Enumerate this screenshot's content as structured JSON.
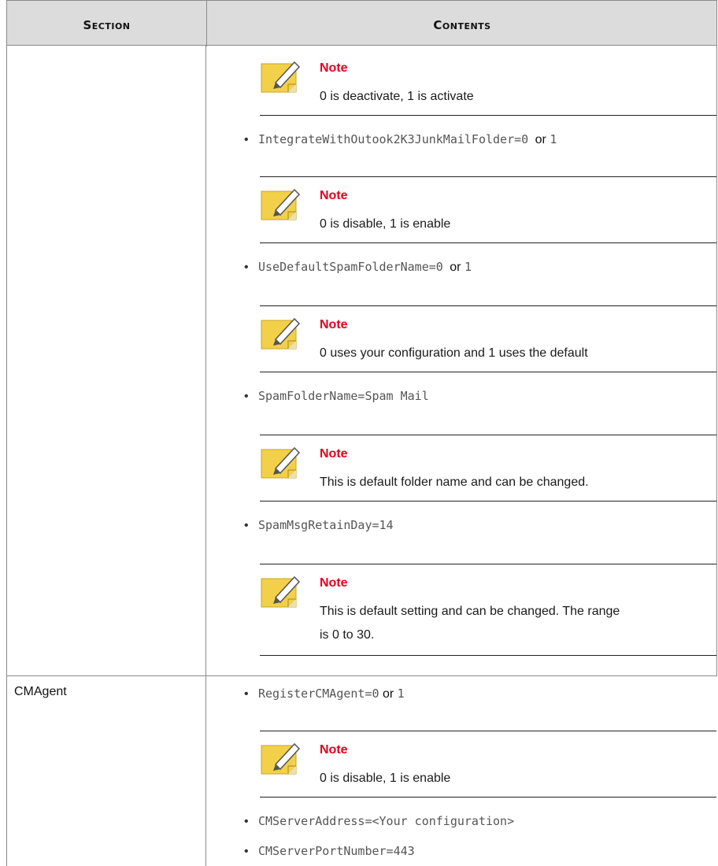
{
  "table": {
    "headers": [
      "Section",
      "Contents"
    ]
  },
  "rows": [
    {
      "section": "",
      "notes": [
        {
          "title": "Note",
          "text": "0 is deactivate, 1 is activate"
        },
        {
          "title": "Note",
          "text": "0 is disable, 1 is enable"
        },
        {
          "title": "Note",
          "text": "0 uses your configuration and 1 uses the default"
        },
        {
          "title": "Note",
          "text": "This is default folder name and can be changed."
        },
        {
          "title": "Note",
          "text_line1": "This is default setting and can be changed. The range",
          "text_line2": "is 0 to 30."
        }
      ],
      "bullets": [
        {
          "code": "IntegrateWithOutook2K3JunkMailFolder=0",
          "or": "or",
          "code2": "1"
        },
        {
          "code": "UseDefaultSpamFolderName=0",
          "or": "or",
          "code2": "1"
        },
        {
          "code": "SpamFolderName=Spam Mail"
        },
        {
          "code": "SpamMsgRetainDay=14"
        }
      ]
    },
    {
      "section": "CMAgent",
      "notes": [
        {
          "title": "Note",
          "text": "0 is disable, 1 is enable"
        }
      ],
      "bullets": [
        {
          "code": "RegisterCMAgent=0",
          "or": "or",
          "code2": "1"
        },
        {
          "code": "CMServerAddress=<Your configuration>"
        },
        {
          "code": "CMServerPortNumber=443"
        }
      ]
    }
  ],
  "colors": {
    "note_title": "#e5001e",
    "header_bg": "#dcdcdc",
    "rule": "#8a8a8a"
  },
  "icon": "note-pencil-icon"
}
